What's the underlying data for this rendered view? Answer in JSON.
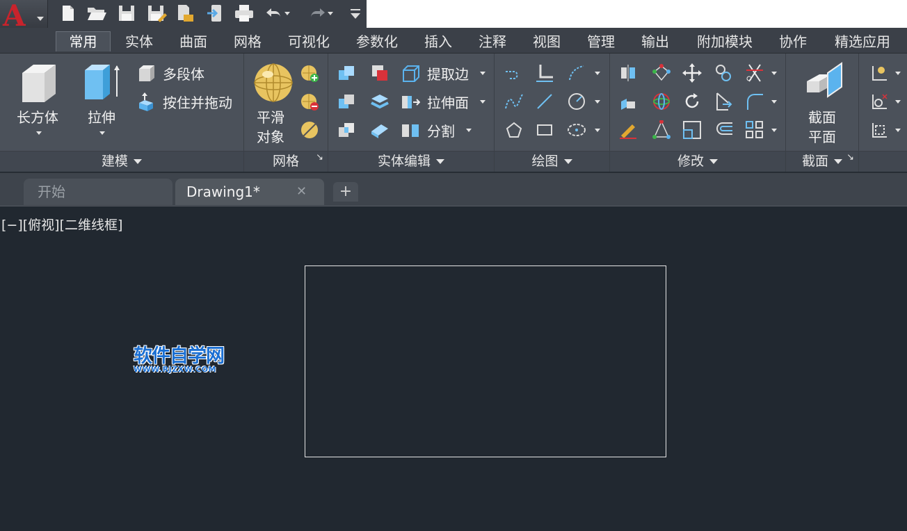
{
  "app": {
    "logo_letter": "A",
    "brand_color": "#c8232c"
  },
  "quick_access": {
    "icons": [
      "new-icon",
      "open-icon",
      "save-icon",
      "save-as-icon",
      "open-from-web-icon",
      "share-icon",
      "print-icon",
      "undo-icon",
      "redo-icon",
      "customize-icon"
    ]
  },
  "ribbon_tabs": [
    "常用",
    "实体",
    "曲面",
    "网格",
    "可视化",
    "参数化",
    "插入",
    "注释",
    "视图",
    "管理",
    "输出",
    "附加模块",
    "协作",
    "精选应用"
  ],
  "panels": {
    "modeling": {
      "footer": "建模",
      "box": "长方体",
      "extrude": "拉伸",
      "polysolid": "多段体",
      "presspull": "按住并拖动"
    },
    "mesh": {
      "footer": "网格",
      "smooth_line1": "平滑",
      "smooth_line2": "对象"
    },
    "solid_edit": {
      "footer": "实体编辑",
      "extract_edges": "提取边",
      "extrude_faces": "拉伸面",
      "slice": "分割"
    },
    "draw": {
      "footer": "绘图"
    },
    "modify": {
      "footer": "修改"
    },
    "section": {
      "footer": "截面",
      "plane_line1": "截面",
      "plane_line2": "平面"
    }
  },
  "file_tabs": {
    "start": "开始",
    "drawing": "Drawing1*",
    "add": "+"
  },
  "viewport": {
    "controls": "[−][俯视][二维线框]"
  },
  "watermark": {
    "title": "软件自学网",
    "url": "WWW.RJZXW.COM"
  }
}
